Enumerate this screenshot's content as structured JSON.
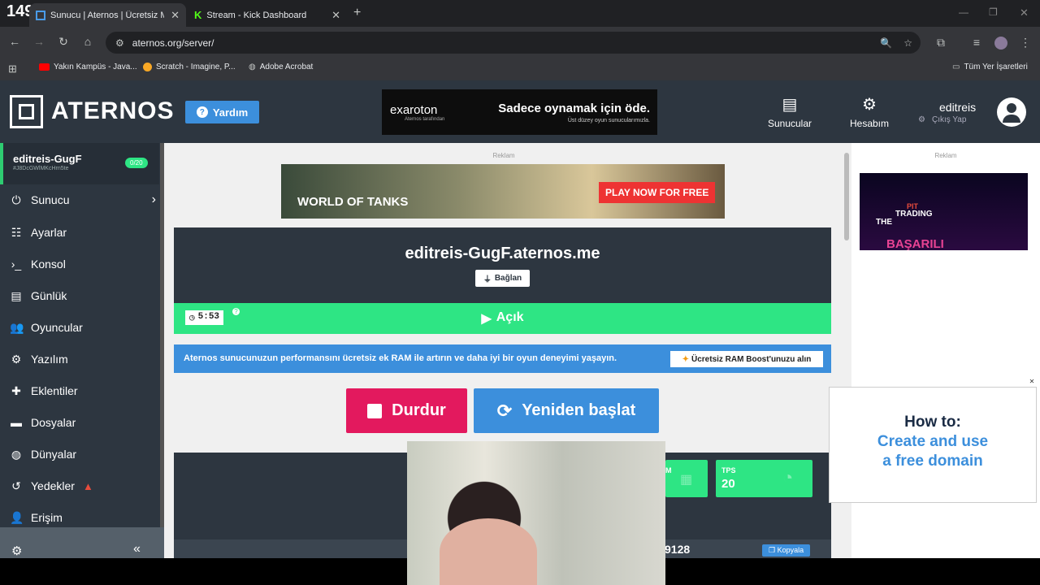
{
  "overlay_counter": "149",
  "tabs": [
    {
      "title": "Sunucu | Aternos | Ücretsiz Min",
      "icon": "aternos-tab-icon"
    },
    {
      "title": "Stream - Kick Dashboard",
      "icon": "kick-tab-icon"
    }
  ],
  "url": "aternos.org/server/",
  "bookmarks": [
    {
      "label": "Yakın Kampüs - Java...",
      "icon": "youtube-icon"
    },
    {
      "label": "Scratch - Imagine, P...",
      "icon": "scratch-icon"
    },
    {
      "label": "Adobe Acrobat",
      "icon": "globe-icon"
    }
  ],
  "all_bookmarks": "Tüm Yer İşaretleri",
  "header": {
    "logo": "ATERNOS",
    "help": "Yardım",
    "ad_brand": "exaroton",
    "ad_brand_sub": "Aternos tarafından",
    "ad_headline": "Sadece oynamak için öde.",
    "ad_sub": "Üst düzey oyun sunucularımızla.",
    "nav_servers": "Sunucular",
    "nav_account": "Hesabım",
    "username": "editreis",
    "logout": "Çıkış Yap"
  },
  "sidebar": {
    "server_name": "editreis-GugF",
    "server_id": "#J8DcGWlMKcHrn5te",
    "players_badge": "0/20",
    "items": [
      {
        "label": "Sunucu",
        "icon": "power-icon"
      },
      {
        "label": "Ayarlar",
        "icon": "sliders-icon"
      },
      {
        "label": "Konsol",
        "icon": "terminal-icon"
      },
      {
        "label": "Günlük",
        "icon": "file-icon"
      },
      {
        "label": "Oyuncular",
        "icon": "users-icon"
      },
      {
        "label": "Yazılım",
        "icon": "cogs-icon"
      },
      {
        "label": "Eklentiler",
        "icon": "puzzle-icon"
      },
      {
        "label": "Dosyalar",
        "icon": "folder-icon"
      },
      {
        "label": "Dünyalar",
        "icon": "globe-icon"
      },
      {
        "label": "Yedekler",
        "icon": "history-icon"
      },
      {
        "label": "Erişim",
        "icon": "user-lock-icon"
      }
    ]
  },
  "main": {
    "ad_label": "Reklam",
    "wot_logo": "WORLD OF TANKS",
    "wot_cta": "PLAY NOW FOR FREE",
    "address": "editreis-GugF.aternos.me",
    "connect": "Bağlan",
    "timer": "5:53",
    "status": "Açık",
    "info_text": "Aternos sunucunuzun performansını ücretsiz ek RAM ile artırın ve daha iyi bir oyun deneyimi yaşayın.",
    "ram_boost": "Ücretsiz RAM Boost'unuzu alın",
    "stop": "Durdur",
    "restart": "Yeniden başlat",
    "ram_label": "M",
    "tps_label": "TPS",
    "tps_value": "20",
    "port_partial": "9128",
    "copy": "Kopyala"
  },
  "right": {
    "ad_label": "Reklam",
    "ad_text1": "PIT",
    "ad_text2": "TRADING",
    "ad_text3": "THE",
    "ad_text4": "BAŞARILI",
    "domain_title": "How to:",
    "domain_line1": "Create and use",
    "domain_line2": "a free domain"
  },
  "colors": {
    "green": "#2ee584",
    "blue": "#3c8fdc",
    "red": "#e3195e",
    "dark": "#2d3640"
  }
}
